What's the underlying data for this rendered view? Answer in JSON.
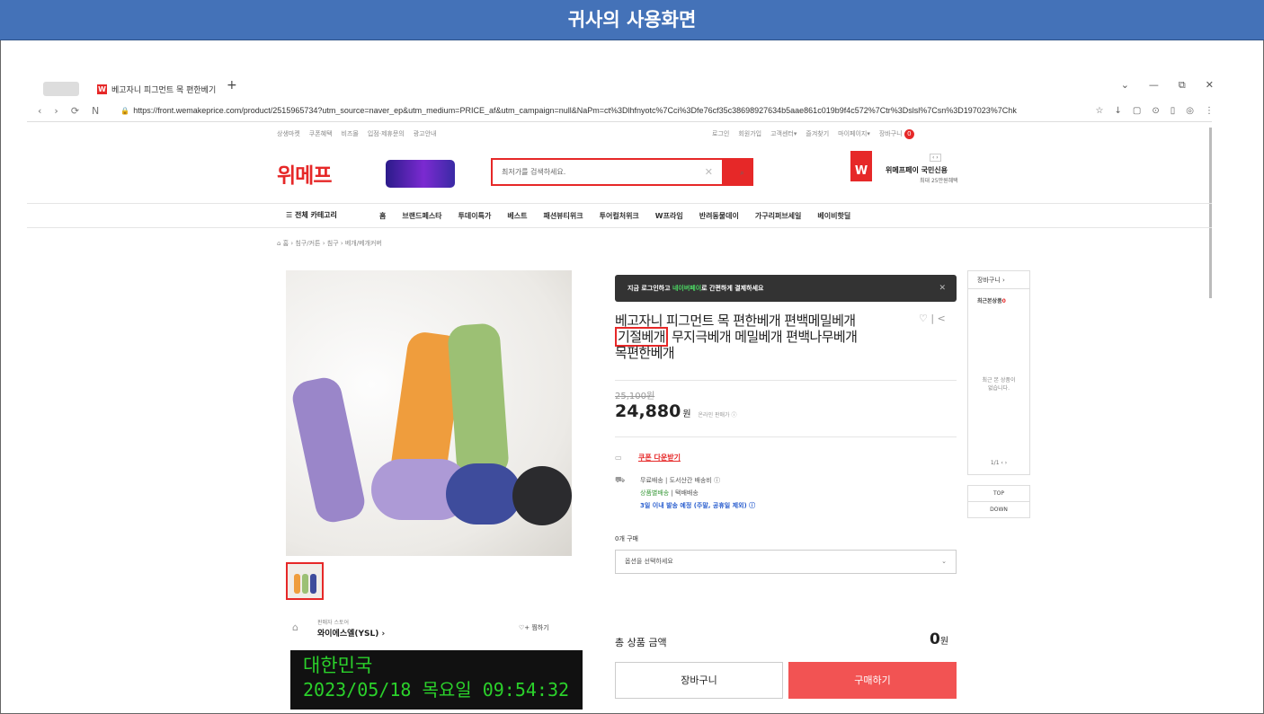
{
  "banner": {
    "title": "귀사의 사용화면"
  },
  "browser": {
    "tab_title": "베고자니 피그먼트 목 편한베기",
    "tab_new": "+",
    "window_controls": [
      "⌄",
      "—",
      "⧉",
      "✕"
    ],
    "nav_buttons": [
      "‹",
      "›",
      "⟳",
      "N"
    ],
    "url": "https://front.wemakeprice.com/product/2515965734?utm_source=naver_ep&utm_medium=PRICE_af&utm_campaign=null&NaPm=ct%3Dlhfnyotc%7Cci%3Dfe76cf35c38698927634b5aae861c019b9f4c572%7Ctr%3Dslsl%7Csn%3D197023%7Chk",
    "address_icons": [
      "☆",
      "↓",
      "▢",
      "⊙",
      "▯",
      "◎",
      "⋮"
    ]
  },
  "site": {
    "util_left": [
      "상생마켓",
      "쿠폰혜택",
      "비즈몰",
      "입점·제휴문의",
      "광고안내"
    ],
    "util_right": [
      "로그인",
      "회원가입",
      "고객센터▾",
      "즐겨찾기",
      "마이페이지▾",
      "장바구니"
    ],
    "cart_count": "0",
    "logo": "위메프",
    "search_placeholder": "최저가를 검색하세요.",
    "card_title": "위메프페이 국민신용",
    "card_sub": "최대 25만원혜택",
    "card_arrows": "‹ ›",
    "category_all": "☰ 전체 카테고리",
    "categories": [
      "홈",
      "브랜드페스타",
      "투데이특가",
      "베스트",
      "패션뷰티위크",
      "투어컬처위크",
      "W프라임",
      "반려동물데이",
      "가구리퍼브세일",
      "베이비핫딜"
    ],
    "breadcrumb": "⌂ 홈  ›  침구/커튼  ›  침구  ›  베개/베개커버"
  },
  "product": {
    "login_banner_pre": "지금 로그인하고 ",
    "login_banner_hl": "네이버페이",
    "login_banner_post": "로 간편하게 결제하세요",
    "login_close": "✕",
    "title_line1": "베고자니 피그먼트 목 편한베개 편백메밀베개",
    "title_hl": "기절베개",
    "title_rest": " 무지극베개 메밀베개 편백나무베개",
    "title_line3": "목편한베개",
    "share_icons": "♡ | <",
    "original_price": "25,100원",
    "price": "24,880",
    "price_unit": "원",
    "price_label": "온라인 판매가 ⓘ",
    "coupon": "쿠폰 다운받기",
    "ship_line1": "무료배송  |  도서산간 배송비 ⓘ",
    "ship_line2_a": "상품별배송",
    "ship_line2_b": "  |  택배배송",
    "ship_line3": "3일 이내 발송 예정 (주말, 공휴일 제외) ⓘ",
    "qty_label": "0개 구매",
    "option_placeholder": "옵션을 선택하세요",
    "total_label": "총 상품 금액",
    "total_value": "0",
    "total_unit": "원",
    "cart_button": "장바구니",
    "buy_button": "구매하기"
  },
  "seller": {
    "label": "판매자 스토어",
    "name": "와이에스엘(YSL) ›",
    "fav": "♡+ 찜하기"
  },
  "sidebar": {
    "cart": "장바구니  ›",
    "recent_label": "최근본상품",
    "recent_count": "0",
    "empty": "최근 본 상품이\n없습니다.",
    "pager": "1/1  ‹ ›",
    "top": "TOP",
    "down": "DOWN"
  },
  "overlay": {
    "country": "대한민국",
    "datetime": "2023/05/18 목요일 09:54:32"
  }
}
